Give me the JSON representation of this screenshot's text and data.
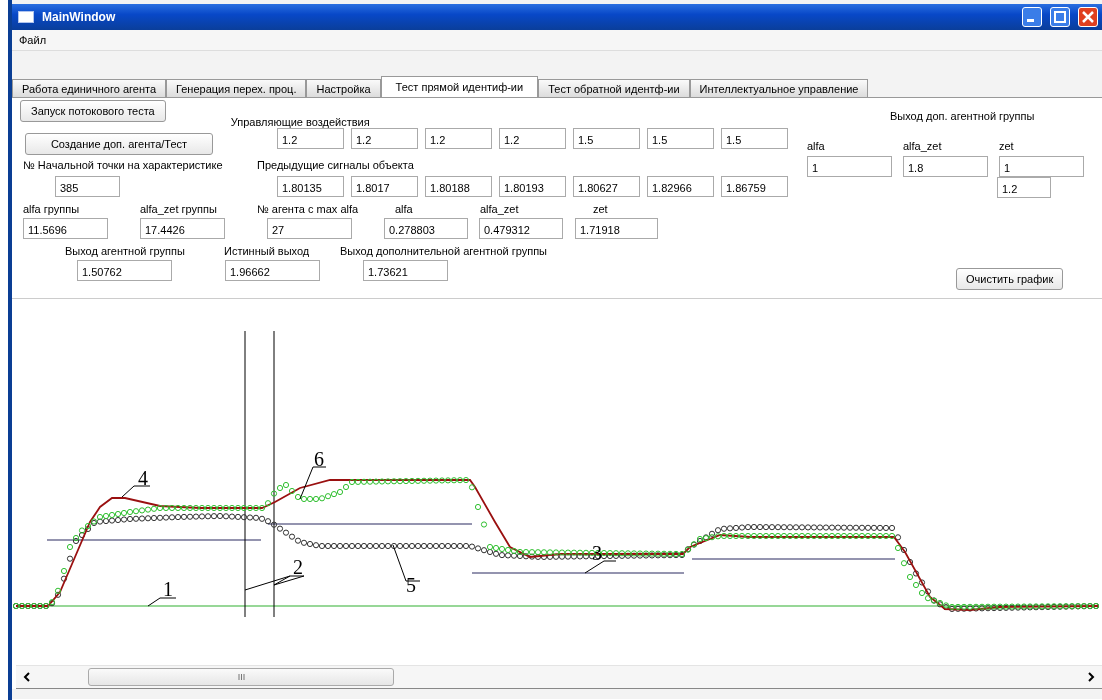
{
  "window": {
    "title": "MainWindow"
  },
  "menu": [
    {
      "label": "Файл"
    }
  ],
  "tabs": [
    {
      "label": "Работа единичного агента",
      "selected": false
    },
    {
      "label": "Генерация перех. проц.",
      "selected": false
    },
    {
      "label": "Настройка",
      "selected": false
    },
    {
      "label": "Тест прямой идентиф-ии",
      "selected": true
    },
    {
      "label": "Тест обратной идентф-ии",
      "selected": false
    },
    {
      "label": "Интеллектуальное управление",
      "selected": false
    }
  ],
  "form": {
    "start_button": "Запуск потокового теста",
    "create_button": "Создание доп. агента/Тест",
    "control_inputs": {
      "label": "Управляющие воздействия",
      "values": [
        "1.2",
        "1.2",
        "1.2",
        "1.2",
        "1.5",
        "1.5",
        "1.5"
      ]
    },
    "start_point": {
      "label": "№ Начальной точки на характеристике",
      "value": "385"
    },
    "previous_signals": {
      "label": "Предыдущие сигналы объекта",
      "values": [
        "1.80135",
        "1.8017",
        "1.80188",
        "1.80193",
        "1.80627",
        "1.82966",
        "1.86759"
      ]
    },
    "params": [
      {
        "label": "alfa группы",
        "value": "11.5696"
      },
      {
        "label": "alfa_zet группы",
        "value": "17.4426"
      },
      {
        "label": "№ агента с max alfa",
        "value": "27"
      },
      {
        "label": "alfa",
        "value": "0.278803"
      },
      {
        "label": "alfa_zet",
        "value": "0.479312"
      },
      {
        "label": "zet",
        "value": "1.71918"
      }
    ],
    "outputs": [
      {
        "label": "Выход агентной группы",
        "value": "1.50762"
      },
      {
        "label": "Истинный выход",
        "value": "1.96662"
      },
      {
        "label": "Выход дополнительной агентной группы",
        "value": "1.73621"
      }
    ]
  },
  "extra_group": {
    "title": "Выход доп. агентной группы",
    "fields": [
      {
        "label": "alfa",
        "value": "1"
      },
      {
        "label": "alfa_zet",
        "value": "1.8"
      },
      {
        "label": "zet",
        "value": "1"
      }
    ],
    "extra_value": "1.2"
  },
  "clear_button": "Очистить график",
  "plot": {
    "labels": [
      "1",
      "2",
      "3",
      "4",
      "5",
      "6"
    ]
  }
}
